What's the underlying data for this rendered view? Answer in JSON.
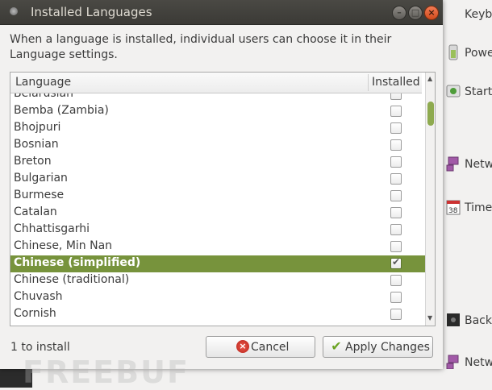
{
  "window": {
    "title": "Installed Languages",
    "description": "When a language is installed, individual users can choose it in their Language settings."
  },
  "list": {
    "col_language": "Language",
    "col_installed": "Installed",
    "rows": [
      {
        "label": "Belarusian",
        "installed": false,
        "selected": false
      },
      {
        "label": "Bemba (Zambia)",
        "installed": false,
        "selected": false
      },
      {
        "label": "Bhojpuri",
        "installed": false,
        "selected": false
      },
      {
        "label": "Bosnian",
        "installed": false,
        "selected": false
      },
      {
        "label": "Breton",
        "installed": false,
        "selected": false
      },
      {
        "label": "Bulgarian",
        "installed": false,
        "selected": false
      },
      {
        "label": "Burmese",
        "installed": false,
        "selected": false
      },
      {
        "label": "Catalan",
        "installed": false,
        "selected": false
      },
      {
        "label": "Chhattisgarhi",
        "installed": false,
        "selected": false
      },
      {
        "label": "Chinese, Min Nan",
        "installed": false,
        "selected": false
      },
      {
        "label": "Chinese (simplified)",
        "installed": true,
        "selected": true
      },
      {
        "label": "Chinese (traditional)",
        "installed": false,
        "selected": false
      },
      {
        "label": "Chuvash",
        "installed": false,
        "selected": false
      },
      {
        "label": "Cornish",
        "installed": false,
        "selected": false
      }
    ]
  },
  "footer": {
    "status": "1 to install",
    "cancel_label": "Cancel",
    "apply_label": "Apply Changes"
  },
  "background": {
    "items": [
      "Keyb",
      "Powe",
      "Start",
      "Netw",
      "Time",
      "Back",
      "Netw"
    ]
  },
  "watermark": "FREEBUF",
  "colors": {
    "selection": "#77933c",
    "titlebar": "#3b3a36",
    "close_button": "#d14c1d"
  }
}
